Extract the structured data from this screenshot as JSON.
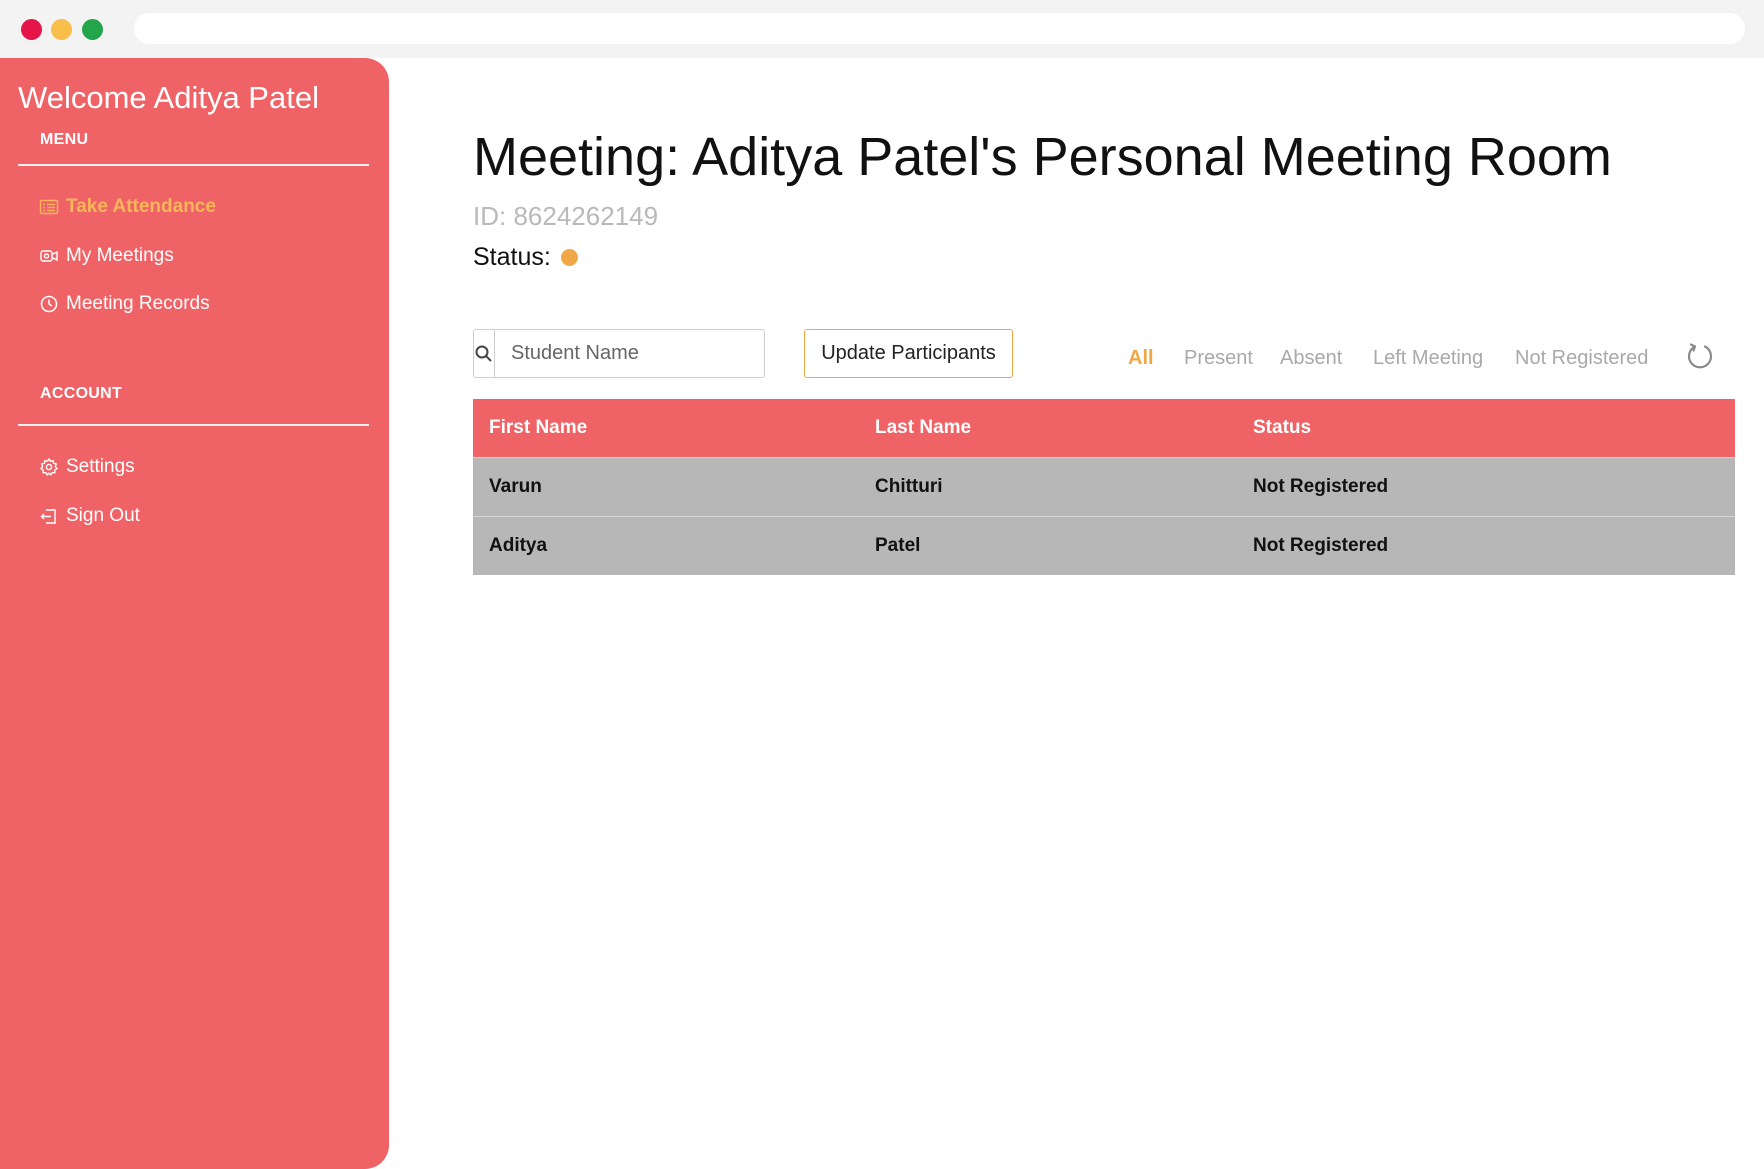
{
  "sidebar": {
    "welcome": "Welcome Aditya Patel",
    "menu_label": "MENU",
    "menu_items": [
      {
        "label": "Take Attendance",
        "icon": "list-icon",
        "active": true
      },
      {
        "label": "My Meetings",
        "icon": "video-camera-icon",
        "active": false
      },
      {
        "label": "Meeting Records",
        "icon": "clock-icon",
        "active": false
      }
    ],
    "account_label": "ACCOUNT",
    "account_items": [
      {
        "label": "Settings",
        "icon": "gear-icon"
      },
      {
        "label": "Sign Out",
        "icon": "sign-out-icon"
      }
    ]
  },
  "meeting": {
    "title": "Meeting: Aditya Patel's Personal Meeting Room",
    "id_text": "ID: 8624262149",
    "status_label": "Status:",
    "status_color": "#f0a847"
  },
  "search": {
    "placeholder": "Student Name",
    "value": ""
  },
  "update_button": "Update Participants",
  "filters": [
    "All",
    "Present",
    "Absent",
    "Left Meeting",
    "Not Registered"
  ],
  "active_filter": "All",
  "table": {
    "headers": [
      "First Name",
      "Last Name",
      "Status"
    ],
    "rows": [
      [
        "Varun",
        "Chitturi",
        "Not Registered"
      ],
      [
        "Aditya",
        "Patel",
        "Not Registered"
      ]
    ]
  },
  "colors": {
    "sidebar": "#ef6367",
    "accent": "#f0a847",
    "row_bg": "#b7b7b7"
  }
}
